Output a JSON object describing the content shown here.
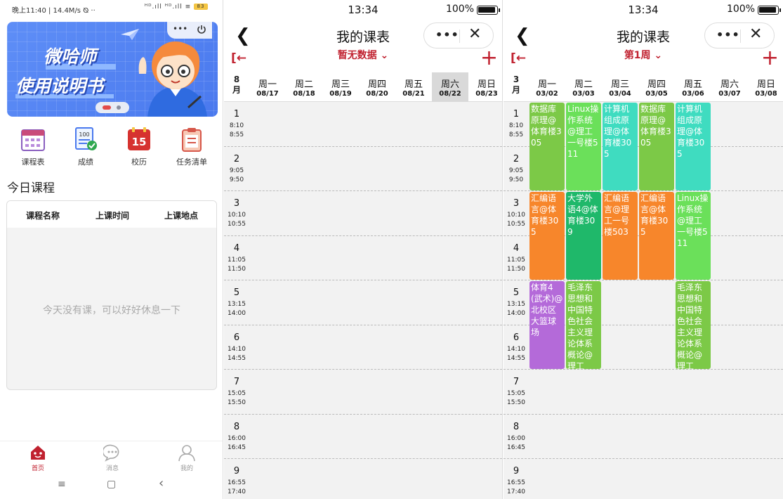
{
  "p1": {
    "status_left": "晚上11:40 | 14.4M/s ⦰ ··",
    "status_right": "ᴴᴰ.ıll ᴴᴰ.ıll ≡",
    "battery": "83",
    "banner_line1": "微哈师",
    "banner_line2": "使用说明书",
    "capsule_dots": "•••",
    "quick": [
      {
        "label": "课程表",
        "icon": "calendar-icon"
      },
      {
        "label": "成绩",
        "icon": "score-icon"
      },
      {
        "label": "校历",
        "icon": "school-calendar-icon"
      },
      {
        "label": "任务清单",
        "icon": "clipboard-icon"
      }
    ],
    "quick_number_100": "100",
    "quick_number_15": "15",
    "section_title": "今日课程",
    "table_headers": [
      "课程名称",
      "上课时间",
      "上课地点"
    ],
    "empty_text": "今天没有课，可以好好休息一下",
    "tabs": [
      {
        "label": "首页",
        "active": true,
        "icon": "home-icon"
      },
      {
        "label": "消息",
        "active": false,
        "icon": "message-icon"
      },
      {
        "label": "我的",
        "active": false,
        "icon": "profile-icon"
      }
    ],
    "nav": {
      "menu": "≡",
      "home": "▢",
      "back": "‹"
    },
    "accent": "#c0212f"
  },
  "p2": {
    "status_time": "13:34",
    "status_pct": "100%",
    "back": "❮",
    "title": "我的课表",
    "capsule_dots": "•••",
    "capsule_close": "✕",
    "subtitle": "暂无数据 ⌄",
    "exit_icon": "[←",
    "plus": "+",
    "month": "8",
    "month_unit": "月",
    "days": [
      {
        "name": "周一",
        "date": "08/17"
      },
      {
        "name": "周二",
        "date": "08/18"
      },
      {
        "name": "周三",
        "date": "08/19"
      },
      {
        "name": "周四",
        "date": "08/20"
      },
      {
        "name": "周五",
        "date": "08/21"
      },
      {
        "name": "周六",
        "date": "08/22",
        "highlight": true
      },
      {
        "name": "周日",
        "date": "08/23"
      }
    ],
    "periods": [
      {
        "n": "1",
        "s": "8:10",
        "e": "8:55"
      },
      {
        "n": "2",
        "s": "9:05",
        "e": "9:50"
      },
      {
        "n": "3",
        "s": "10:10",
        "e": "10:55"
      },
      {
        "n": "4",
        "s": "11:05",
        "e": "11:50"
      },
      {
        "n": "5",
        "s": "13:15",
        "e": "14:00"
      },
      {
        "n": "6",
        "s": "14:10",
        "e": "14:55"
      },
      {
        "n": "7",
        "s": "15:05",
        "e": "15:50"
      },
      {
        "n": "8",
        "s": "16:00",
        "e": "16:45"
      },
      {
        "n": "9",
        "s": "16:55",
        "e": "17:40"
      }
    ]
  },
  "p3": {
    "status_time": "13:34",
    "status_pct": "100%",
    "back": "❮",
    "title": "我的课表",
    "capsule_dots": "•••",
    "capsule_close": "✕",
    "subtitle": "第1周 ⌄",
    "exit_icon": "[←",
    "plus": "+",
    "month": "3",
    "month_unit": "月",
    "days": [
      {
        "name": "周一",
        "date": "03/02"
      },
      {
        "name": "周二",
        "date": "03/03"
      },
      {
        "name": "周三",
        "date": "03/04"
      },
      {
        "name": "周四",
        "date": "03/05"
      },
      {
        "name": "周五",
        "date": "03/06"
      },
      {
        "name": "周六",
        "date": "03/07"
      },
      {
        "name": "周日",
        "date": "03/08"
      }
    ],
    "periods": [
      {
        "n": "1",
        "s": "8:10",
        "e": "8:55"
      },
      {
        "n": "2",
        "s": "9:05",
        "e": "9:50"
      },
      {
        "n": "3",
        "s": "10:10",
        "e": "10:55"
      },
      {
        "n": "4",
        "s": "11:05",
        "e": "11:50"
      },
      {
        "n": "5",
        "s": "13:15",
        "e": "14:00"
      },
      {
        "n": "6",
        "s": "14:10",
        "e": "14:55"
      },
      {
        "n": "7",
        "s": "15:05",
        "e": "15:50"
      },
      {
        "n": "8",
        "s": "16:00",
        "e": "16:45"
      },
      {
        "n": "9",
        "s": "16:55",
        "e": "17:40"
      }
    ],
    "courses": [
      {
        "day": 0,
        "start": 1,
        "span": 2,
        "text": "数据库原理@体育楼305",
        "color": "#7cc947"
      },
      {
        "day": 1,
        "start": 1,
        "span": 2,
        "text": "Linux操作系统@理工一号楼511",
        "color": "#6be05a"
      },
      {
        "day": 2,
        "start": 1,
        "span": 2,
        "text": "计算机组成原理@体育楼305",
        "color": "#3fdcc0"
      },
      {
        "day": 3,
        "start": 1,
        "span": 2,
        "text": "数据库原理@体育楼305",
        "color": "#7cc947"
      },
      {
        "day": 4,
        "start": 1,
        "span": 2,
        "text": "计算机组成原理@体育楼305",
        "color": "#3fdcc0"
      },
      {
        "day": 0,
        "start": 3,
        "span": 2,
        "text": "汇编语言@体育楼305",
        "color": "#f7862b"
      },
      {
        "day": 1,
        "start": 3,
        "span": 2,
        "text": "大学外语4@体育楼309",
        "color": "#1fb86a"
      },
      {
        "day": 2,
        "start": 3,
        "span": 2,
        "text": "汇编语言@理工一号楼503",
        "color": "#f7862b"
      },
      {
        "day": 3,
        "start": 3,
        "span": 2,
        "text": "汇编语言@体育楼305",
        "color": "#f7862b"
      },
      {
        "day": 4,
        "start": 3,
        "span": 2,
        "text": "Linux操作系统@理工一号楼511",
        "color": "#6be05a"
      },
      {
        "day": 0,
        "start": 5,
        "span": 2,
        "text": "体育4(武术)@北校区大篮球场",
        "color": "#b46ad9"
      },
      {
        "day": 1,
        "start": 5,
        "span": 2,
        "text": "毛泽东思想和中国特色社会主义理论体系概论@理工",
        "color": "#7cc947"
      },
      {
        "day": 4,
        "start": 5,
        "span": 2,
        "text": "毛泽东思想和中国特色社会主义理论体系概论@理工",
        "color": "#7cc947"
      }
    ]
  }
}
